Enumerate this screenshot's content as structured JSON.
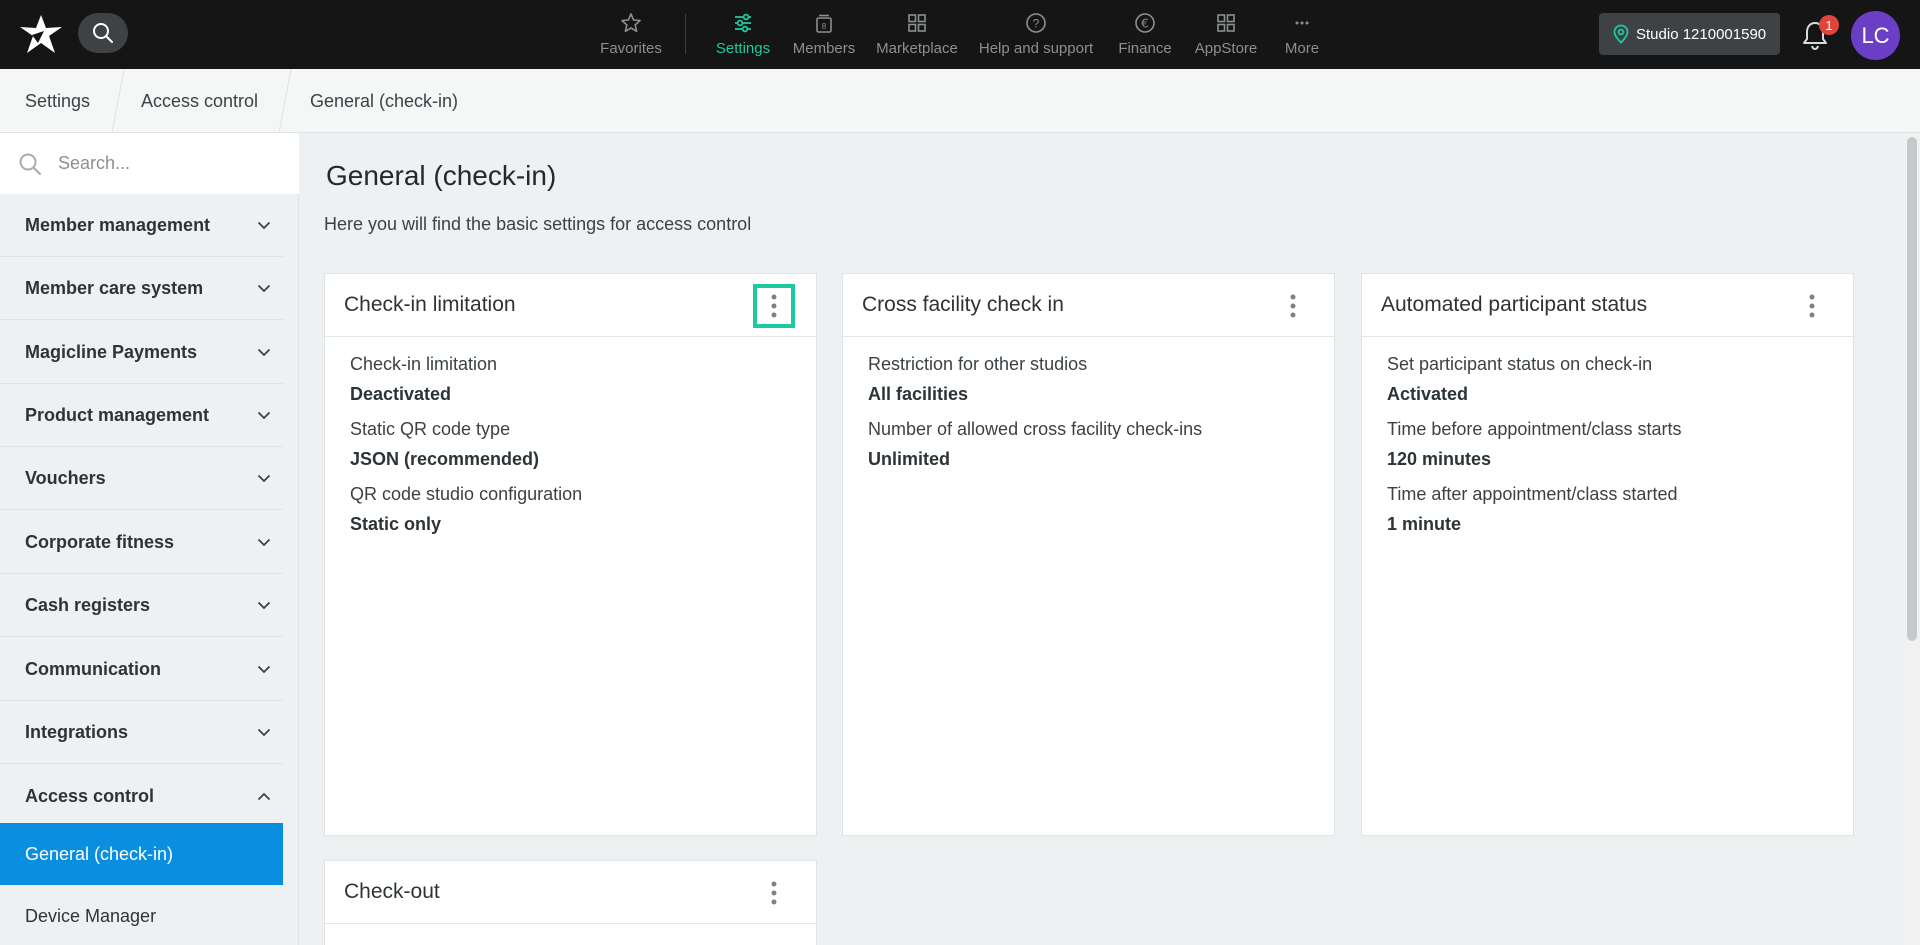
{
  "topbar": {
    "nav": [
      {
        "label": "Favorites",
        "icon": "star-icon"
      },
      {
        "label": "Settings",
        "icon": "sliders-icon",
        "active": true
      },
      {
        "label": "Members",
        "icon": "members-icon"
      },
      {
        "label": "Marketplace",
        "icon": "grid-icon"
      },
      {
        "label": "Help and support",
        "icon": "help-icon"
      },
      {
        "label": "Finance",
        "icon": "euro-icon"
      },
      {
        "label": "AppStore",
        "icon": "apps-icon"
      },
      {
        "label": "More",
        "icon": "more-icon"
      }
    ],
    "studio_label": "Studio 1210001590",
    "notification_count": "1",
    "avatar_initials": "LC",
    "accent_color": "#1ec8a0"
  },
  "breadcrumb": [
    "Settings",
    "Access control",
    "General (check-in)"
  ],
  "sidebar": {
    "search_placeholder": "Search...",
    "items": [
      "Member management",
      "Member care system",
      "Magicline Payments",
      "Product management",
      "Vouchers",
      "Corporate fitness",
      "Cash registers",
      "Communication",
      "Integrations",
      "Access control"
    ],
    "subitems": [
      "General (check-in)",
      "Device Manager"
    ],
    "active_color": "#0a8fe0"
  },
  "main": {
    "title": "General (check-in)",
    "description": "Here you will find the basic settings for access control",
    "cards": [
      {
        "title": "Check-in limitation",
        "fields": [
          {
            "label": "Check-in limitation",
            "value": "Deactivated"
          },
          {
            "label": "Static QR code type",
            "value": "JSON (recommended)"
          },
          {
            "label": "QR code studio configuration",
            "value": "Static only"
          }
        ]
      },
      {
        "title": "Cross facility check in",
        "fields": [
          {
            "label": "Restriction for other studios",
            "value": "All facilities"
          },
          {
            "label": "Number of allowed cross facility check-ins",
            "value": "Unlimited"
          }
        ]
      },
      {
        "title": "Automated participant status",
        "fields": [
          {
            "label": "Set participant status on check-in",
            "value": "Activated"
          },
          {
            "label": "Time before appointment/class starts",
            "value": "120 minutes"
          },
          {
            "label": "Time after appointment/class started",
            "value": "1 minute"
          }
        ]
      },
      {
        "title": "Check-out",
        "fields": []
      }
    ]
  }
}
